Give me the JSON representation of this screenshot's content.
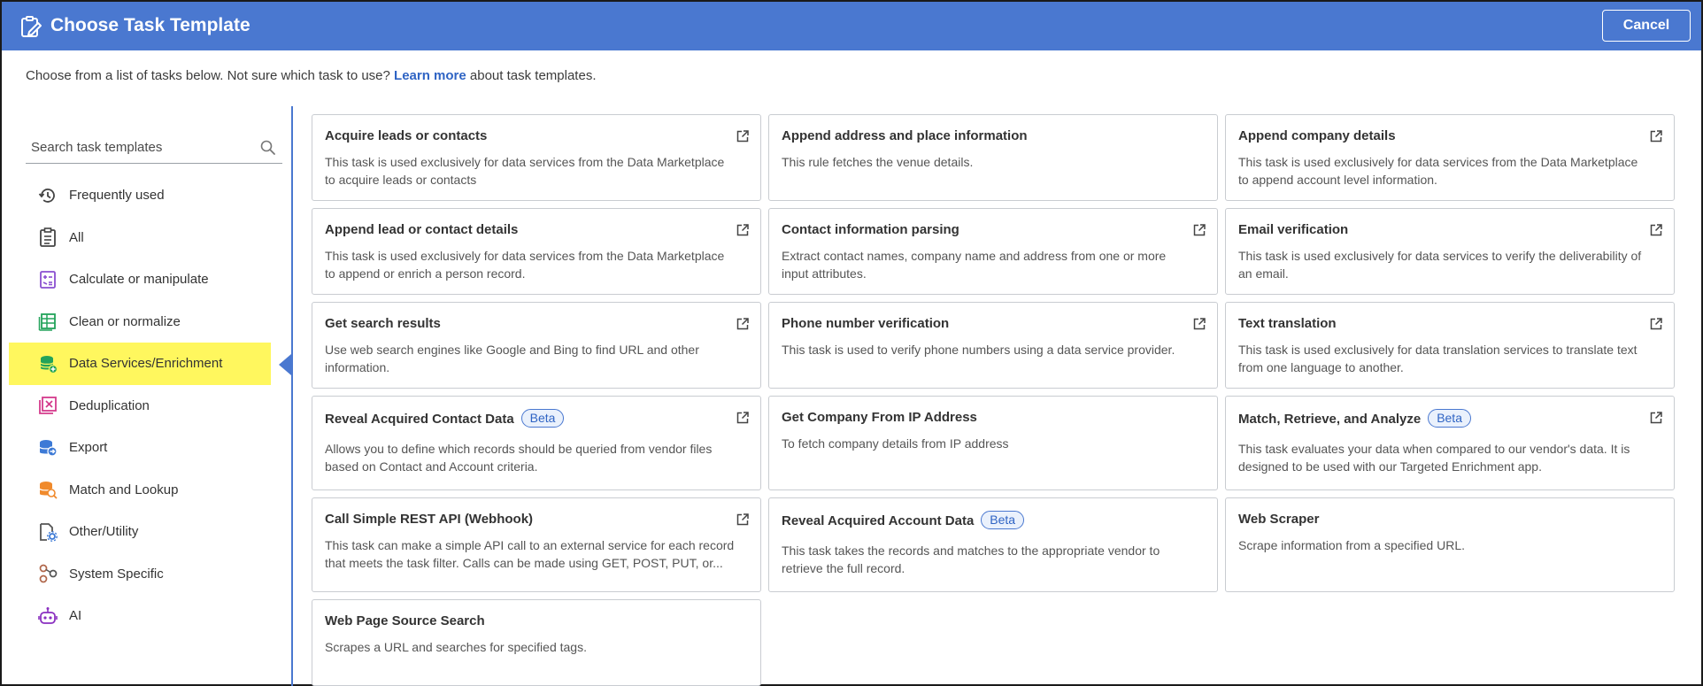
{
  "header": {
    "title": "Choose Task Template",
    "cancel_label": "Cancel"
  },
  "intro": {
    "before": "Choose from a list of tasks below. Not sure which task to use?",
    "link": "Learn more",
    "after": "about task templates."
  },
  "search": {
    "placeholder": "Search task templates"
  },
  "categories": [
    {
      "label": "Frequently used",
      "icon": "history-icon"
    },
    {
      "label": "All",
      "icon": "clipboard-list-icon"
    },
    {
      "label": "Calculate or manipulate",
      "icon": "calculator-icon"
    },
    {
      "label": "Clean or normalize",
      "icon": "clean-table-icon"
    },
    {
      "label": "Data Services/Enrichment",
      "icon": "database-plus-icon",
      "selected": true
    },
    {
      "label": "Deduplication",
      "icon": "dedupe-icon"
    },
    {
      "label": "Export",
      "icon": "export-database-icon"
    },
    {
      "label": "Match and Lookup",
      "icon": "database-search-icon"
    },
    {
      "label": "Other/Utility",
      "icon": "file-gear-icon"
    },
    {
      "label": "System Specific",
      "icon": "system-nodes-icon"
    },
    {
      "label": "AI",
      "icon": "robot-icon"
    }
  ],
  "colors": {
    "header": "#4a78d0",
    "highlight": "#fff75e",
    "link": "#2f64c4"
  },
  "cards": [
    {
      "title": "Acquire leads or contacts",
      "desc": "This task is used exclusively for data services from the Data Marketplace to acquire leads or contacts",
      "ext": true
    },
    {
      "title": "Append address and place information",
      "desc": "This rule fetches the venue details.",
      "ext": false
    },
    {
      "title": "Append company details",
      "desc": "This task is used exclusively for data services from the Data Marketplace to append account level information.",
      "ext": true
    },
    {
      "title": "Append lead or contact details",
      "desc": "This task is used exclusively for data services from the Data Marketplace to append or enrich a person record.",
      "ext": true
    },
    {
      "title": "Contact information parsing",
      "desc": "Extract contact names, company name and address from one or more input attributes.",
      "ext": true
    },
    {
      "title": "Email verification",
      "desc": "This task is used exclusively for data services to verify the deliverability of an email.",
      "ext": true
    },
    {
      "title": "Get search results",
      "desc": "Use web search engines like Google and Bing to find URL and other information.",
      "ext": true
    },
    {
      "title": "Phone number verification",
      "desc": "This task is used to verify phone numbers using a data service provider.",
      "ext": true
    },
    {
      "title": "Text translation",
      "desc": "This task is used exclusively for data translation services to translate text from one language to another.",
      "ext": true
    },
    {
      "title": "Reveal Acquired Contact Data",
      "badge": "Beta",
      "desc": "Allows you to define which records should be queried from vendor files based on Contact and Account criteria.",
      "ext": true
    },
    {
      "title": "Get Company From IP Address",
      "desc": "To fetch company details from IP address",
      "ext": false
    },
    {
      "title": "Match, Retrieve, and Analyze",
      "badge": "Beta",
      "desc": "This task evaluates your data when compared to our vendor's data. It is designed to be used with our Targeted Enrichment app.",
      "ext": true
    },
    {
      "title": "Call Simple REST API (Webhook)",
      "desc": "This task can make a simple API call to an external service for each record that meets the task filter. Calls can be made using GET, POST, PUT, or...",
      "ext": true
    },
    {
      "title": "Reveal Acquired Account Data",
      "badge": "Beta",
      "desc": "This task takes the records and matches to the appropriate vendor to retrieve the full record.",
      "ext": false
    },
    {
      "title": "Web Scraper",
      "desc": "Scrape information from a specified URL.",
      "ext": false
    },
    {
      "title": "Web Page Source Search",
      "desc": "Scrapes a URL and searches for specified tags.",
      "ext": false
    }
  ]
}
